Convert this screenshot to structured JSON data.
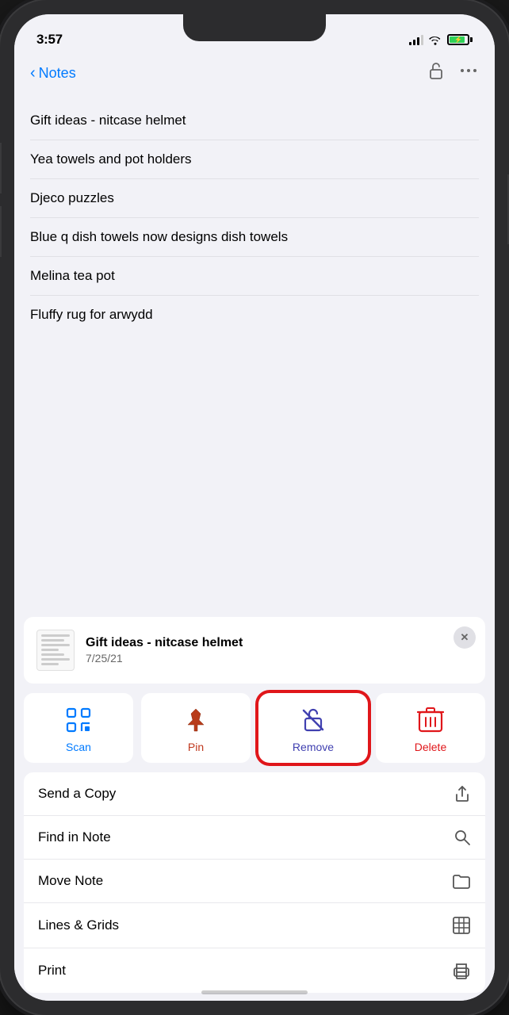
{
  "statusBar": {
    "time": "3:57",
    "locationArrow": "▶",
    "batteryColor": "#30d158"
  },
  "navBar": {
    "backLabel": "Notes",
    "unlockIcon": "🔓",
    "moreIcon": "···"
  },
  "notesList": {
    "items": [
      "Gift ideas - nitcase helmet",
      "Yea towels and pot holders",
      "Djeco puzzles",
      "Blue q dish towels now designs dish towels",
      "Melina tea pot",
      "Fluffy rug for arwydd"
    ]
  },
  "notePreview": {
    "title": "Gift ideas - nitcase helmet",
    "date": "7/25/21",
    "closeLabel": "✕"
  },
  "actionButtons": {
    "scan": {
      "label": "Scan",
      "icon": "scan"
    },
    "pin": {
      "label": "Pin",
      "icon": "pin"
    },
    "remove": {
      "label": "Remove",
      "icon": "remove"
    },
    "delete": {
      "label": "Delete",
      "icon": "delete"
    }
  },
  "menuItems": [
    {
      "label": "Send a Copy",
      "icon": "share"
    },
    {
      "label": "Find in Note",
      "icon": "search"
    },
    {
      "label": "Move Note",
      "icon": "folder"
    },
    {
      "label": "Lines & Grids",
      "icon": "grid"
    },
    {
      "label": "Print",
      "icon": "print"
    }
  ]
}
